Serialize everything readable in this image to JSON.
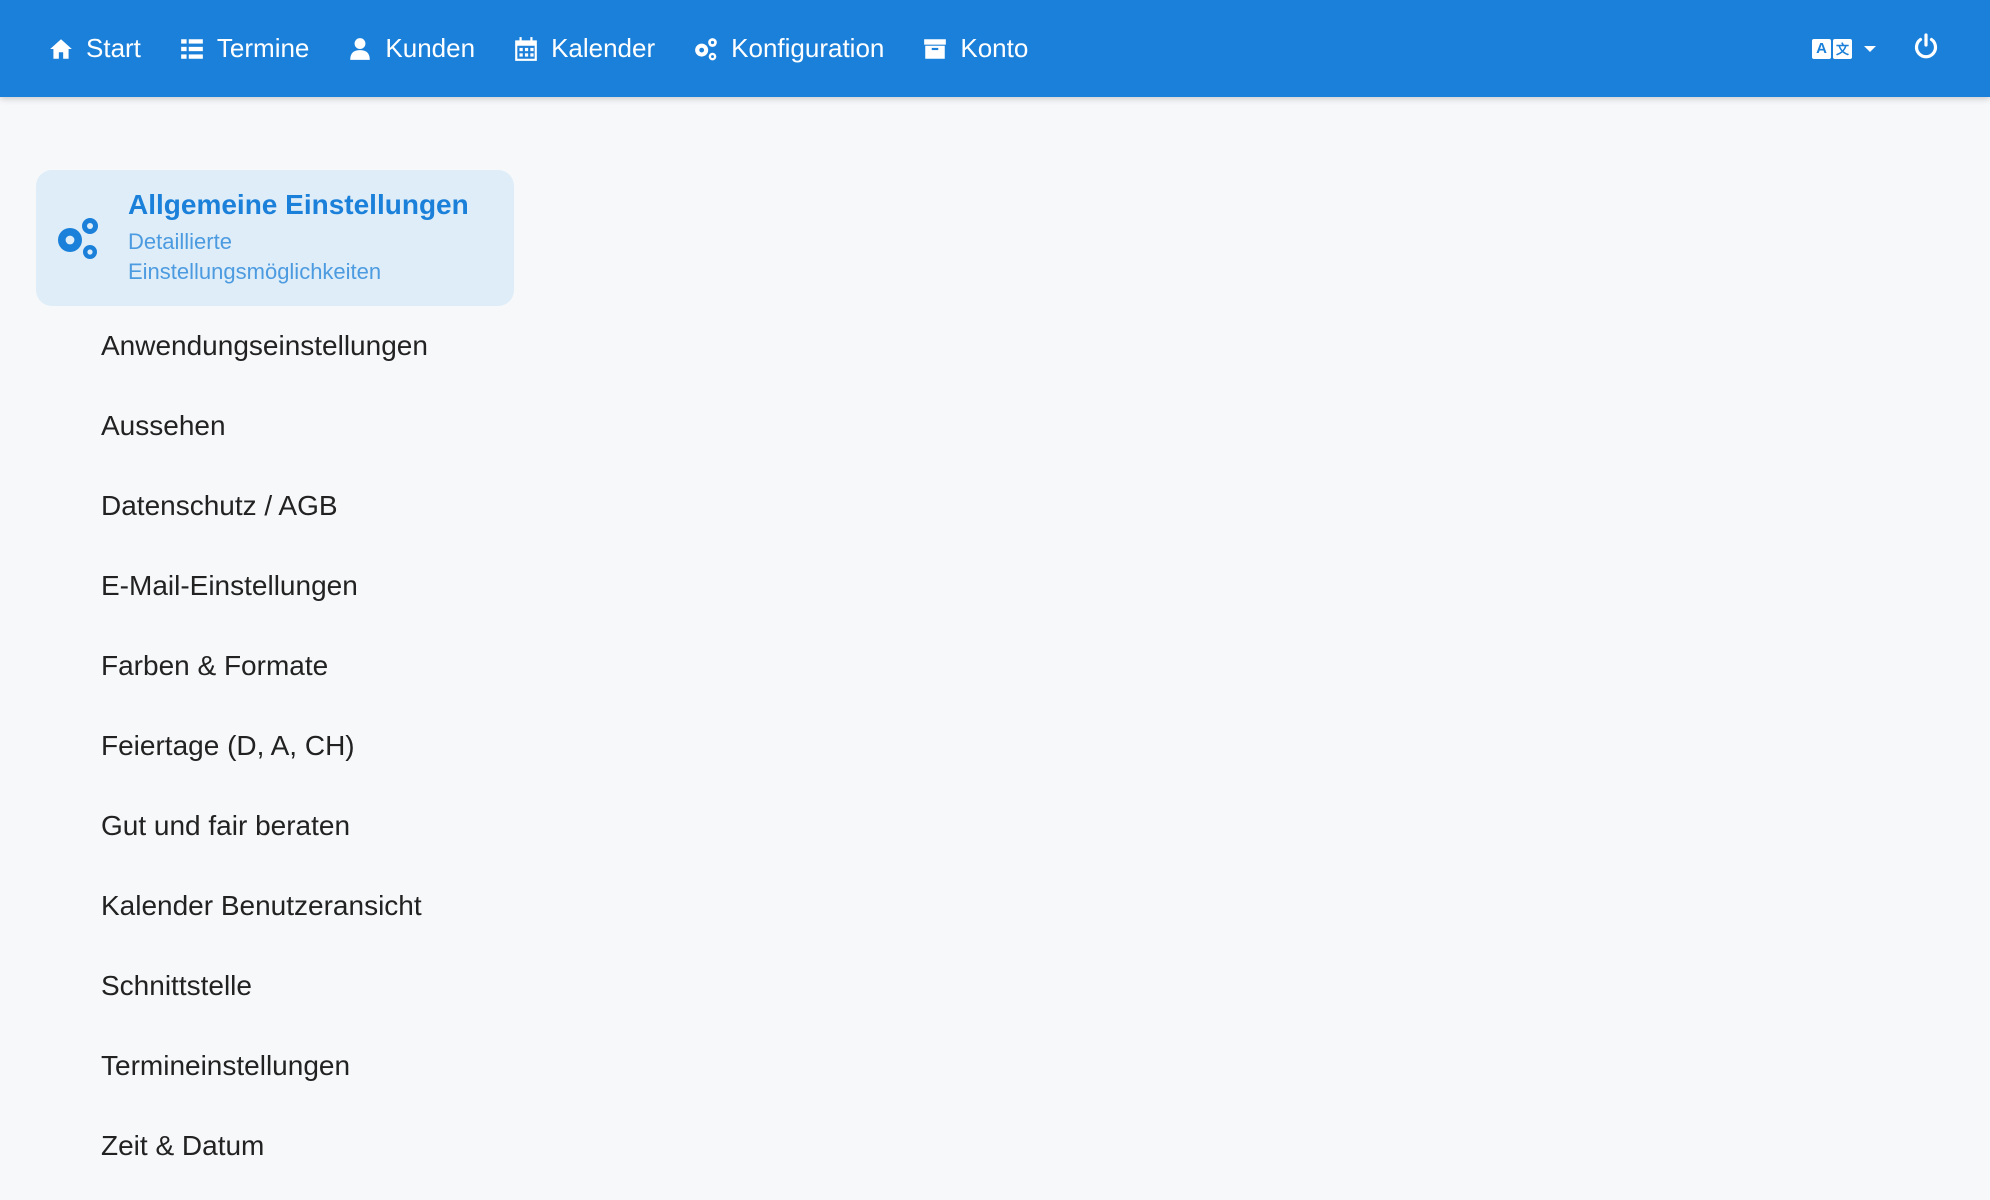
{
  "nav": {
    "items": [
      {
        "label": "Start",
        "icon": "home-icon"
      },
      {
        "label": "Termine",
        "icon": "list-icon"
      },
      {
        "label": "Kunden",
        "icon": "user-icon"
      },
      {
        "label": "Kalender",
        "icon": "calendar-icon"
      },
      {
        "label": "Konfiguration",
        "icon": "cogs-icon"
      },
      {
        "label": "Konto",
        "icon": "archive-icon"
      }
    ],
    "language_icon": "translate-icon",
    "power_icon": "power-icon"
  },
  "sidebar": {
    "active": {
      "title": "Allgemeine Einstellungen",
      "subtitle": "Detaillierte Einstellungsmöglichkeiten",
      "icon": "cogs-icon"
    },
    "items": [
      "Anwendungseinstellungen",
      "Aussehen",
      "Datenschutz / AGB",
      "E-Mail-Einstellungen",
      "Farben & Formate",
      "Feiertage (D, A, CH)",
      "Gut und fair beraten",
      "Kalender Benutzeransicht",
      "Schnittstelle",
      "Termineinstellungen",
      "Zeit & Datum"
    ]
  },
  "colors": {
    "topbar": "#1b80d9",
    "background": "#f7f8fa",
    "active_card": "#deedf8",
    "accent": "#1b80d9"
  }
}
